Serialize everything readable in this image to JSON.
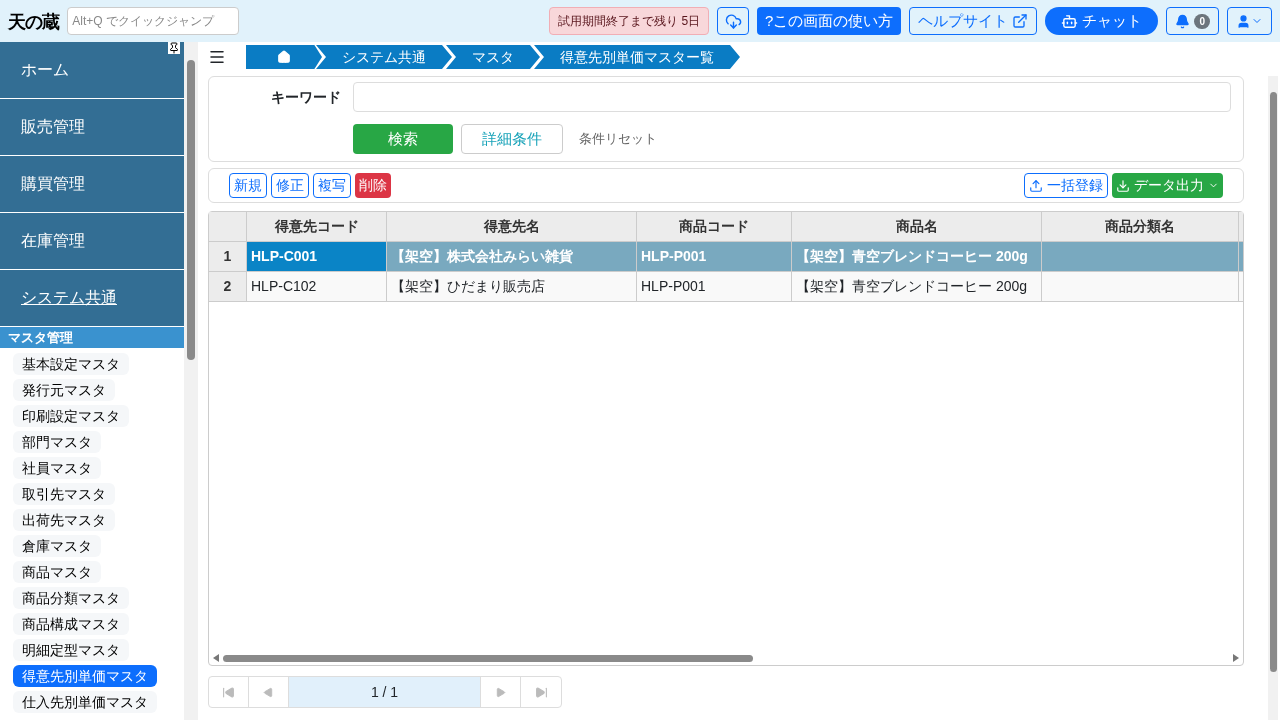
{
  "header": {
    "logo": "天の蔵",
    "quick_jump": {
      "placeholder": "Alt+Q でクイックジャンプ"
    },
    "trial_badge": "試用期間終了まで残り 5日",
    "help_button": "?この画面の使い方",
    "help_site_link": "ヘルプサイト",
    "chat_button": "チャット",
    "notification_count": "0"
  },
  "sidebar": {
    "items": [
      {
        "label": "ホーム",
        "selected": false
      },
      {
        "label": "販売管理",
        "selected": false
      },
      {
        "label": "購買管理",
        "selected": false
      },
      {
        "label": "在庫管理",
        "selected": false
      },
      {
        "label": "システム共通",
        "selected": true
      }
    ],
    "section": "マスタ管理",
    "sub_items": [
      {
        "label": "基本設定マスタ",
        "selected": false
      },
      {
        "label": "発行元マスタ",
        "selected": false
      },
      {
        "label": "印刷設定マスタ",
        "selected": false
      },
      {
        "label": "部門マスタ",
        "selected": false
      },
      {
        "label": "社員マスタ",
        "selected": false
      },
      {
        "label": "取引先マスタ",
        "selected": false
      },
      {
        "label": "出荷先マスタ",
        "selected": false
      },
      {
        "label": "倉庫マスタ",
        "selected": false
      },
      {
        "label": "商品マスタ",
        "selected": false
      },
      {
        "label": "商品分類マスタ",
        "selected": false
      },
      {
        "label": "商品構成マスタ",
        "selected": false
      },
      {
        "label": "明細定型マスタ",
        "selected": false
      },
      {
        "label": "得意先別単価マスタ",
        "selected": true
      },
      {
        "label": "仕入先別単価マスタ",
        "selected": false
      }
    ]
  },
  "breadcrumb": [
    "システム共通",
    "マスタ",
    "得意先別単価マスター覧"
  ],
  "search": {
    "keyword_label": "キーワード",
    "search_button": "検索",
    "detail_button": "詳細条件",
    "reset_link": "条件リセット"
  },
  "toolbar": {
    "left": [
      {
        "label": "新規",
        "kind": "outline"
      },
      {
        "label": "修正",
        "kind": "outline"
      },
      {
        "label": "複写",
        "kind": "outline"
      },
      {
        "label": "削除",
        "kind": "danger"
      }
    ],
    "bulk_button": "一括登録",
    "export_button": "データ出力"
  },
  "table": {
    "columns": [
      "得意先コード",
      "得意先名",
      "商品コード",
      "商品名",
      "商品分類名"
    ],
    "rows": [
      {
        "number": "1",
        "selected": true,
        "cells": [
          "HLP-C001",
          "【架空】株式会社みらい雑貨",
          "HLP-P001",
          "【架空】青空ブレンドコーヒー 200g",
          ""
        ]
      },
      {
        "number": "2",
        "selected": false,
        "cells": [
          "HLP-C102",
          "【架空】ひだまり販売店",
          "HLP-P001",
          "【架空】青空ブレンドコーヒー 200g",
          ""
        ]
      }
    ]
  },
  "pager": {
    "page": "1 / 1"
  }
}
